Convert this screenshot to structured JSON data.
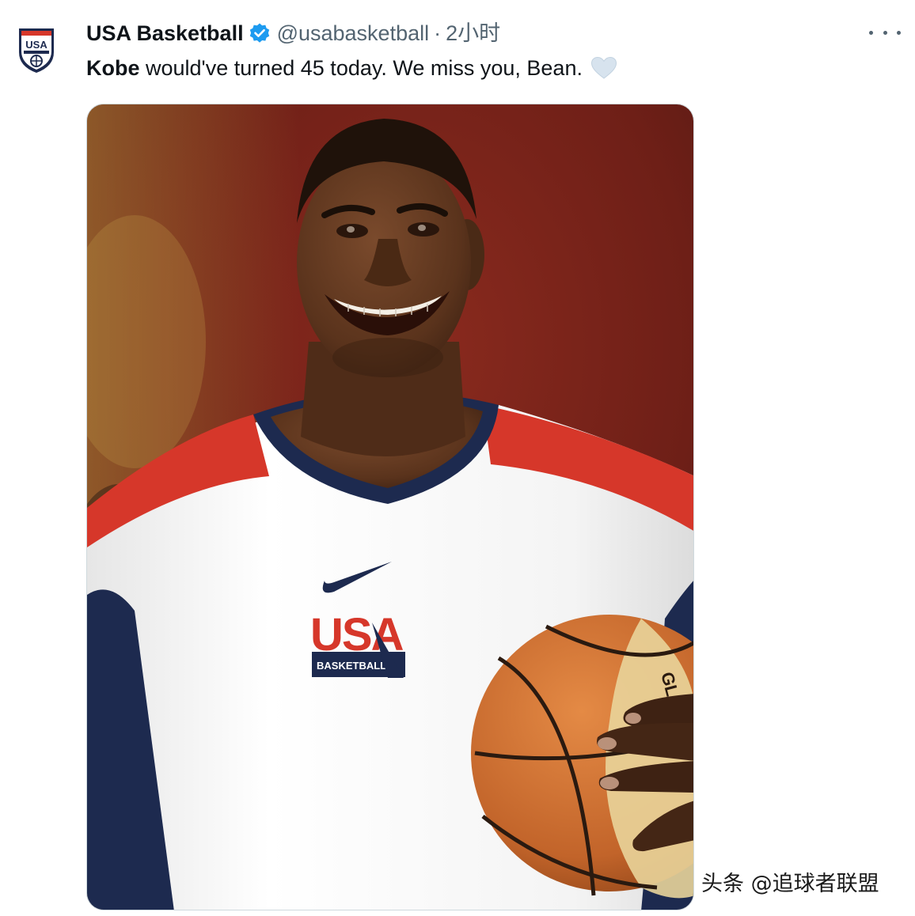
{
  "tweet": {
    "display_name": "USA Basketball",
    "handle": "@usabasketball",
    "separator": "·",
    "time": "2小时",
    "text_bold": "Kobe",
    "text_rest": " would've turned 45 today. We miss you, Bean.",
    "more_icon": "more-horizontal-icon",
    "verified_icon": "verified-badge-icon",
    "emoji_icon": "white-heart-icon"
  },
  "avatar": {
    "logo_text": "USA"
  },
  "photo": {
    "jersey_text": "USA",
    "jersey_subtext": "BASKETBALL",
    "ball_text": "GL"
  },
  "watermark": {
    "text": "头条 @追球者联盟"
  },
  "colors": {
    "verified": "#1d9bf0",
    "text": "#0f1419",
    "secondary": "#536471",
    "jersey_red": "#d6372a",
    "jersey_navy": "#1d2a4f"
  }
}
